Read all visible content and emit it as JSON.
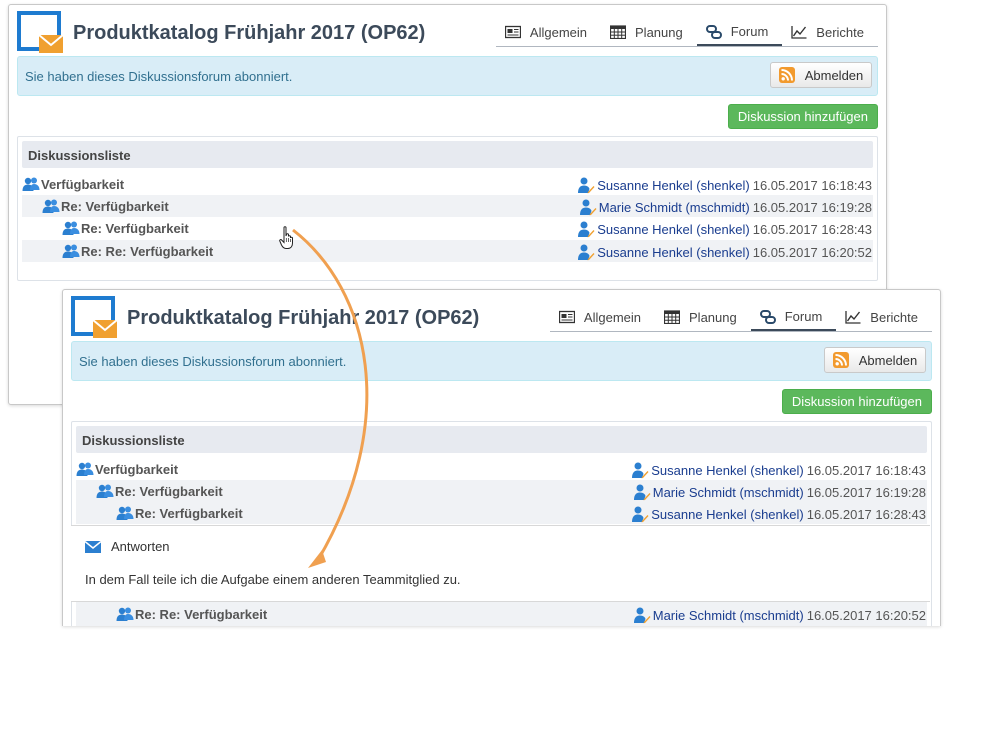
{
  "title": "Produktkatalog Frühjahr 2017 (OP62)",
  "tabs": [
    "Allgemein",
    "Planung",
    "Forum",
    "Berichte"
  ],
  "active_tab": "Forum",
  "subscribed_message": "Sie haben dieses Diskussionsforum abonniert.",
  "unsubscribe_label": "Abmelden",
  "add_discussion_label": "Diskussion hinzufügen",
  "list_title": "Diskussionsliste",
  "colors": {
    "accent_green": "#5cb85c",
    "info_bg": "#d9edf7",
    "link_blue": "#1a3d8f",
    "arrow_orange": "#f0a050",
    "icon_blue": "#2b7fd0"
  },
  "threads": [
    {
      "subject": "Verfügbarkeit",
      "author": "Susanne Henkel (shenkel)",
      "date": "16.05.2017 16:18:43"
    },
    {
      "subject": "Re: Verfügbarkeit",
      "author": "Marie Schmidt (mschmidt)",
      "date": "16.05.2017 16:19:28"
    },
    {
      "subject": "Re: Verfügbarkeit",
      "author": "Susanne Henkel (shenkel)",
      "date": "16.05.2017 16:28:43"
    },
    {
      "subject": "Re: Re: Verfügbarkeit",
      "author": "Susanne Henkel (shenkel)",
      "date": "16.05.2017 16:20:52"
    }
  ],
  "reply": {
    "label": "Antworten",
    "text": "In dem Fall teile ich die Aufgabe einem anderen Teammitglied zu."
  },
  "threads2_after": {
    "subject": "Re: Re: Verfügbarkeit",
    "author": "Marie Schmidt (mschmidt)",
    "date": "16.05.2017 16:20:52"
  }
}
